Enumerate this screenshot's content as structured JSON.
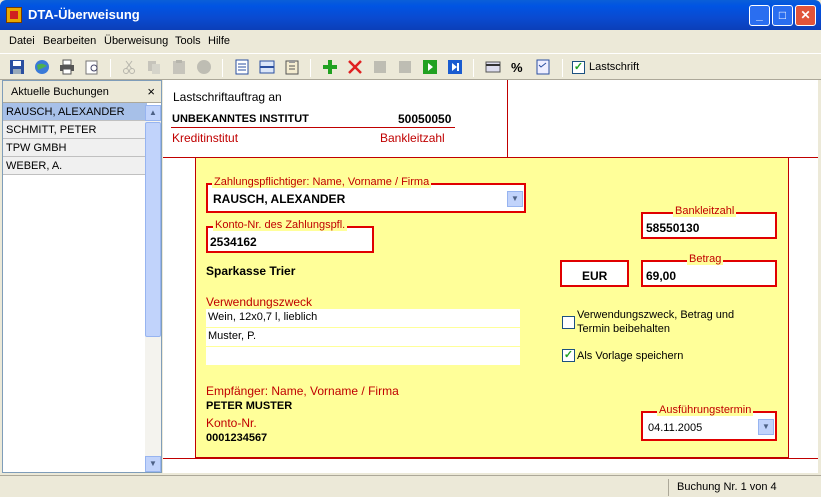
{
  "window": {
    "title": "DTA-Überweisung",
    "min": "_",
    "max": "□",
    "close": "✕"
  },
  "menu": [
    "Datei",
    "Bearbeiten",
    "Überweisung",
    "Tools",
    "Hilfe"
  ],
  "toolbar": {
    "lastschrift_label": "Lastschrift",
    "lastschrift_checked": true
  },
  "left_panel": {
    "title": "Aktuelle Buchungen",
    "close": "×",
    "items": [
      "RAUSCH, ALEXANDER",
      "SCHMITT, PETER",
      "TPW GMBH",
      "WEBER, A."
    ]
  },
  "top_form": {
    "heading": "Lastschriftauftrag an",
    "institute": "UNBEKANNTES INSTITUT",
    "blz": "50050050",
    "kreditinstitut_label": "Kreditinstitut",
    "bankleitzahl_label": "Bankleitzahl"
  },
  "form": {
    "payer_label": "Zahlungspflichtiger: Name, Vorname / Firma",
    "payer_value": "RAUSCH, ALEXANDER",
    "account_label": "Konto-Nr. des Zahlungspfl.",
    "account_value": "2534162",
    "blz_label": "Bankleitzahl",
    "blz_value": "58550130",
    "bank_name": "Sparkasse Trier",
    "currency": "EUR",
    "amount_label": "Betrag",
    "amount_value": "69,00",
    "purpose_label": "Verwendungszweck",
    "purpose_lines": [
      "Wein, 12x0,7 l, lieblich",
      "Muster, P.",
      ""
    ],
    "keep_label_1": "Verwendungszweck, Betrag und",
    "keep_label_2": "Termin beibehalten",
    "keep_checked": false,
    "template_label": "Als Vorlage speichern",
    "template_checked": true,
    "recipient_label": "Empfänger: Name, Vorname / Firma",
    "recipient_value": "PETER MUSTER",
    "recipient_account_label": "Konto-Nr.",
    "recipient_account_value": "0001234567",
    "date_label": "Ausführungstermin",
    "date_value": "04.11.2005"
  },
  "status": {
    "text": "Buchung Nr. 1 von 4"
  },
  "colors": {
    "accent_red": "#c00000",
    "form_bg": "#ffff99",
    "title_blue": "#0054e3"
  }
}
